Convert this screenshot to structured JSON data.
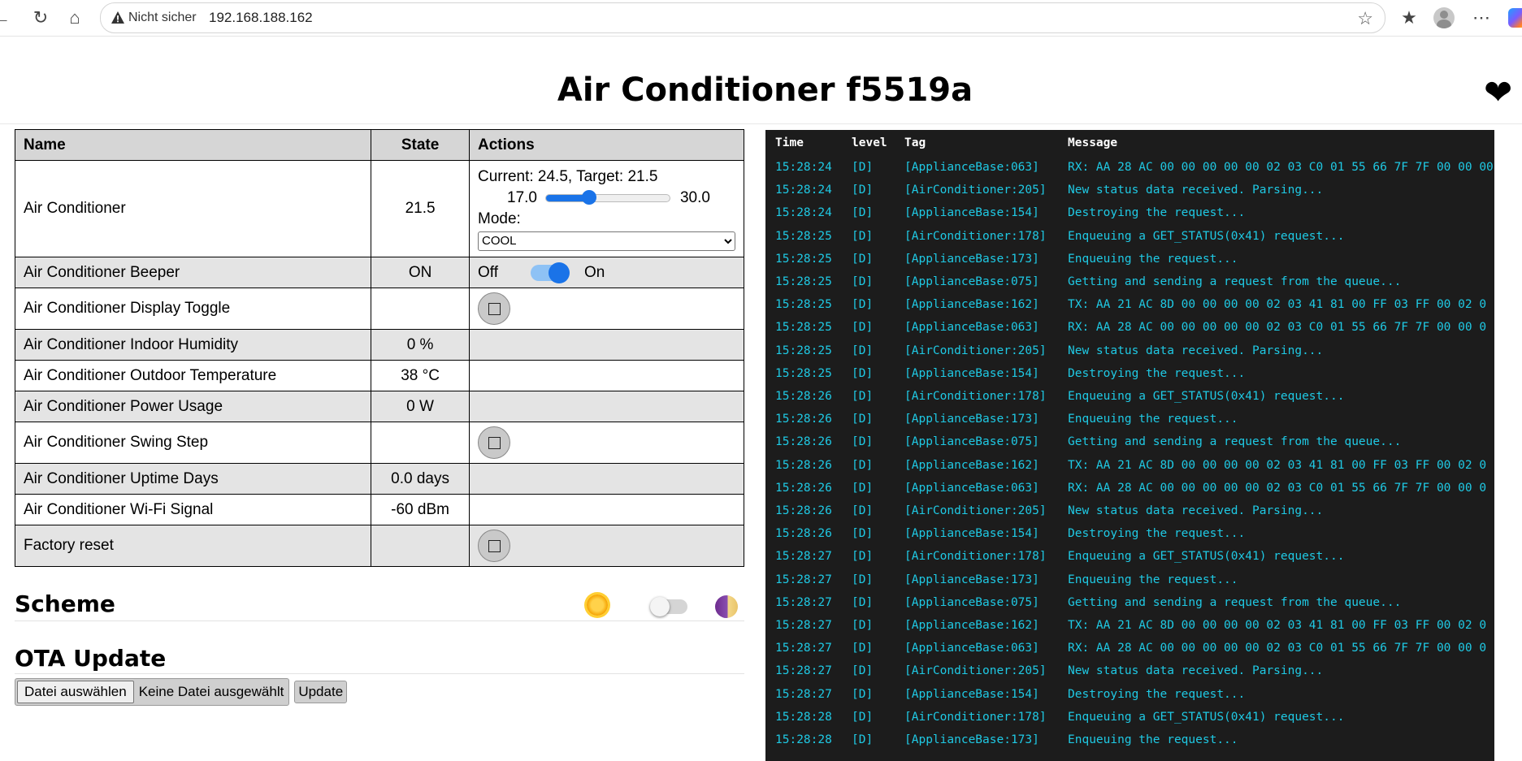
{
  "browser": {
    "security_label": "Nicht sicher",
    "url": "192.168.188.162"
  },
  "page": {
    "title": "Air Conditioner f5519a"
  },
  "table": {
    "headers": {
      "name": "Name",
      "state": "State",
      "actions": "Actions"
    },
    "climate": {
      "name": "Air Conditioner",
      "state": "21.5",
      "status_text": "Current: 24.5, Target: 21.5",
      "min": "17.0",
      "max": "30.0",
      "target_value": 21.5,
      "mode_label": "Mode:",
      "mode_selected": "COOL"
    },
    "beeper": {
      "name": "Air Conditioner Beeper",
      "state": "ON",
      "off_label": "Off",
      "on_label": "On",
      "on": true
    },
    "display_toggle": {
      "name": "Air Conditioner Display Toggle",
      "state": ""
    },
    "humidity": {
      "name": "Air Conditioner Indoor Humidity",
      "state": "0 %"
    },
    "outdoor_temp": {
      "name": "Air Conditioner Outdoor Temperature",
      "state": "38 °C"
    },
    "power": {
      "name": "Air Conditioner Power Usage",
      "state": "0 W"
    },
    "swing": {
      "name": "Air Conditioner Swing Step",
      "state": ""
    },
    "uptime": {
      "name": "Air Conditioner Uptime Days",
      "state": "0.0 days"
    },
    "wifi": {
      "name": "Air Conditioner Wi-Fi Signal",
      "state": "-60 dBm"
    },
    "factory": {
      "name": "Factory reset",
      "state": ""
    }
  },
  "scheme": {
    "title": "Scheme",
    "dark": false
  },
  "ota": {
    "title": "OTA Update",
    "choose_file": "Datei auswählen",
    "no_file": "Keine Datei ausgewählt",
    "update_button": "Update"
  },
  "log": {
    "headers": {
      "time": "Time",
      "level": "level",
      "tag": "Tag",
      "message": "Message"
    },
    "rows": [
      {
        "time": "15:28:24",
        "level": "[D]",
        "tag": "[ApplianceBase:063]",
        "message": "RX: AA 28 AC 00 00 00 00 00 02 03 C0 01 55 66 7F 7F 00 00 00"
      },
      {
        "time": "15:28:24",
        "level": "[D]",
        "tag": "[AirConditioner:205]",
        "message": "New status data received. Parsing..."
      },
      {
        "time": "15:28:24",
        "level": "[D]",
        "tag": "[ApplianceBase:154]",
        "message": "Destroying the request..."
      },
      {
        "time": "15:28:25",
        "level": "[D]",
        "tag": "[AirConditioner:178]",
        "message": "Enqueuing a GET_STATUS(0x41) request..."
      },
      {
        "time": "15:28:25",
        "level": "[D]",
        "tag": "[ApplianceBase:173]",
        "message": "Enqueuing the request..."
      },
      {
        "time": "15:28:25",
        "level": "[D]",
        "tag": "[ApplianceBase:075]",
        "message": "Getting and sending a request from the queue..."
      },
      {
        "time": "15:28:25",
        "level": "[D]",
        "tag": "[ApplianceBase:162]",
        "message": "TX: AA 21 AC 8D 00 00 00 00 02 03 41 81 00 FF 03 FF 00 02 0"
      },
      {
        "time": "15:28:25",
        "level": "[D]",
        "tag": "[ApplianceBase:063]",
        "message": "RX: AA 28 AC 00 00 00 00 00 02 03 C0 01 55 66 7F 7F 00 00 0"
      },
      {
        "time": "15:28:25",
        "level": "[D]",
        "tag": "[AirConditioner:205]",
        "message": "New status data received. Parsing..."
      },
      {
        "time": "15:28:25",
        "level": "[D]",
        "tag": "[ApplianceBase:154]",
        "message": "Destroying the request..."
      },
      {
        "time": "15:28:26",
        "level": "[D]",
        "tag": "[AirConditioner:178]",
        "message": "Enqueuing a GET_STATUS(0x41) request..."
      },
      {
        "time": "15:28:26",
        "level": "[D]",
        "tag": "[ApplianceBase:173]",
        "message": "Enqueuing the request..."
      },
      {
        "time": "15:28:26",
        "level": "[D]",
        "tag": "[ApplianceBase:075]",
        "message": "Getting and sending a request from the queue..."
      },
      {
        "time": "15:28:26",
        "level": "[D]",
        "tag": "[ApplianceBase:162]",
        "message": "TX: AA 21 AC 8D 00 00 00 00 02 03 41 81 00 FF 03 FF 00 02 0"
      },
      {
        "time": "15:28:26",
        "level": "[D]",
        "tag": "[ApplianceBase:063]",
        "message": "RX: AA 28 AC 00 00 00 00 00 02 03 C0 01 55 66 7F 7F 00 00 0"
      },
      {
        "time": "15:28:26",
        "level": "[D]",
        "tag": "[AirConditioner:205]",
        "message": "New status data received. Parsing..."
      },
      {
        "time": "15:28:26",
        "level": "[D]",
        "tag": "[ApplianceBase:154]",
        "message": "Destroying the request..."
      },
      {
        "time": "15:28:27",
        "level": "[D]",
        "tag": "[AirConditioner:178]",
        "message": "Enqueuing a GET_STATUS(0x41) request..."
      },
      {
        "time": "15:28:27",
        "level": "[D]",
        "tag": "[ApplianceBase:173]",
        "message": "Enqueuing the request..."
      },
      {
        "time": "15:28:27",
        "level": "[D]",
        "tag": "[ApplianceBase:075]",
        "message": "Getting and sending a request from the queue..."
      },
      {
        "time": "15:28:27",
        "level": "[D]",
        "tag": "[ApplianceBase:162]",
        "message": "TX: AA 21 AC 8D 00 00 00 00 02 03 41 81 00 FF 03 FF 00 02 0"
      },
      {
        "time": "15:28:27",
        "level": "[D]",
        "tag": "[ApplianceBase:063]",
        "message": "RX: AA 28 AC 00 00 00 00 00 02 03 C0 01 55 66 7F 7F 00 00 0"
      },
      {
        "time": "15:28:27",
        "level": "[D]",
        "tag": "[AirConditioner:205]",
        "message": "New status data received. Parsing..."
      },
      {
        "time": "15:28:27",
        "level": "[D]",
        "tag": "[ApplianceBase:154]",
        "message": "Destroying the request..."
      },
      {
        "time": "15:28:28",
        "level": "[D]",
        "tag": "[AirConditioner:178]",
        "message": "Enqueuing a GET_STATUS(0x41) request..."
      },
      {
        "time": "15:28:28",
        "level": "[D]",
        "tag": "[ApplianceBase:173]",
        "message": "Enqueuing the request..."
      }
    ]
  },
  "icons": [
    "back-icon",
    "refresh-icon",
    "home-icon",
    "warning-icon",
    "favorite-star-icon",
    "favorites-icon",
    "profile-icon",
    "more-icon",
    "copilot-icon",
    "heart-icon",
    "sun-icon",
    "moon-icon",
    "press-icon"
  ],
  "colors": {
    "log_bg": "#1c1c1c",
    "log_text": "#1fc9e4",
    "accent": "#1a73e8",
    "header_bg": "#d6d6d6",
    "row_alt": "#e4e4e4"
  }
}
